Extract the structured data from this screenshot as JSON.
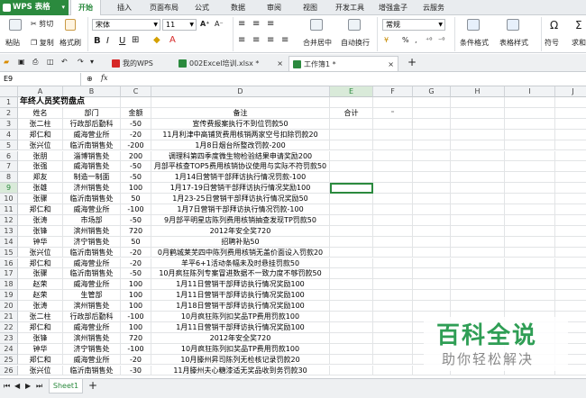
{
  "app": {
    "title": "WPS 表格",
    "accent": "#2b8a3e"
  },
  "menu": {
    "tabs": [
      "开始",
      "插入",
      "页面布局",
      "公式",
      "数据",
      "审阅",
      "视图",
      "开发工具",
      "增强盒子",
      "云服务"
    ],
    "active": "开始"
  },
  "ribbon": {
    "cut": "剪切",
    "paste": "粘贴",
    "copy": "复制",
    "format_painter": "格式刷",
    "font_name": "宋体",
    "font_size": "11",
    "bold": "B",
    "italic": "I",
    "underline": "U",
    "font_grow": "A⁺",
    "font_shrink": "A⁻",
    "merge_center": "合并居中",
    "wrap": "自动换行",
    "number_format": "常规",
    "percent": "%",
    "comma": "‚",
    "dec_inc": "⁺⁰",
    "dec_dec": "⁻⁰",
    "cond_format": "条件格式",
    "table_style": "表格样式",
    "symbol": "符号",
    "sum": "求和",
    "icons": [
      "scissors-icon",
      "paste-icon",
      "copy-icon",
      "brush-icon"
    ]
  },
  "doc_tabs": [
    "我的WPS",
    "002Excel培训.xlsx *",
    "工作簿1 *"
  ],
  "doc_tab_new": "+",
  "formula_bar": {
    "name_box": "E9",
    "fx": "fx",
    "value": ""
  },
  "columns": [
    "A",
    "B",
    "C",
    "D",
    "E",
    "F",
    "G",
    "H",
    "I",
    "J"
  ],
  "rows": [
    {
      "n": "1",
      "a": "年终人员奖罚盘点",
      "b": "",
      "c": "",
      "d": "",
      "e": "",
      "f": ""
    },
    {
      "n": "2",
      "a": "姓名",
      "b": "部门",
      "c": "金额",
      "d": "备注",
      "e": "合计",
      "f": "⁼"
    },
    {
      "n": "3",
      "a": "张二柱",
      "b": "行政部后勤科",
      "c": "-50",
      "d": "宣传费报案执行不到位罚款50",
      "e": "",
      "f": ""
    },
    {
      "n": "4",
      "a": "郑仁和",
      "b": "威海营业所",
      "c": "-20",
      "d": "11月利津中高铺货费用核销两家空号扣除罚款20",
      "e": "",
      "f": ""
    },
    {
      "n": "5",
      "a": "张兴位",
      "b": "临沂南销售处",
      "c": "-200",
      "d": "1月8日烟台所整改罚款-200",
      "e": "",
      "f": ""
    },
    {
      "n": "6",
      "a": "张朋",
      "b": "淄博销售处",
      "c": "200",
      "d": "调理科第四季度微生物检验结果申请奖励200",
      "e": "",
      "f": ""
    },
    {
      "n": "7",
      "a": "张强",
      "b": "威海销售处",
      "c": "-50",
      "d": "月部平核查TOP5费用核销协议使用与实际不符罚款50",
      "e": "",
      "f": ""
    },
    {
      "n": "8",
      "a": "郑友",
      "b": "制造一制面",
      "c": "-50",
      "d": "1月14日营销干部拜访执行情况罚款-100",
      "e": "",
      "f": ""
    },
    {
      "n": "9",
      "a": "张雄",
      "b": "济州销售处",
      "c": "100",
      "d": "1月17-19日营销干部拜访执行情况奖励100",
      "e": "",
      "f": ""
    },
    {
      "n": "10",
      "a": "张骤",
      "b": "临沂南销售处",
      "c": "50",
      "d": "1月23-25日营销干部拜访执行情况奖励50",
      "e": "",
      "f": ""
    },
    {
      "n": "11",
      "a": "郑仁和",
      "b": "威海营业所",
      "c": "-100",
      "d": "1月7日营销干部拜访执行情况罚款-100",
      "e": "",
      "f": ""
    },
    {
      "n": "12",
      "a": "张涛",
      "b": "市场部",
      "c": "-50",
      "d": "9月部平明星店陈列费用核销抽查发现TP罚款50",
      "e": "",
      "f": ""
    },
    {
      "n": "13",
      "a": "张锋",
      "b": "滨州销售处",
      "c": "720",
      "d": "2012年安全奖720",
      "e": "",
      "f": ""
    },
    {
      "n": "14",
      "a": "钟华",
      "b": "济宁销售处",
      "c": "50",
      "d": "招聘补贴50",
      "e": "",
      "f": ""
    },
    {
      "n": "15",
      "a": "张兴位",
      "b": "临沂南销售处",
      "c": "-20",
      "d": "0月鹤城莱芜四中陈列费用核销无盖价面设入罚款20",
      "e": "",
      "f": ""
    },
    {
      "n": "16",
      "a": "郑仁和",
      "b": "威海营业所",
      "c": "-20",
      "d": "羊平6+1活动条幅未及时悬挂罚款50",
      "e": "",
      "f": ""
    },
    {
      "n": "17",
      "a": "张骤",
      "b": "临沂南销售处",
      "c": "-50",
      "d": "10月疯狂陈列专案冒进数据不一致力度不够罚款50",
      "e": "",
      "f": ""
    },
    {
      "n": "18",
      "a": "赵荣",
      "b": "威海营业所",
      "c": "100",
      "d": "1月11日营销干部拜访执行情况奖励100",
      "e": "",
      "f": ""
    },
    {
      "n": "19",
      "a": "赵荣",
      "b": "生管部",
      "c": "100",
      "d": "1月11日营销干部拜访执行情况奖励100",
      "e": "",
      "f": ""
    },
    {
      "n": "20",
      "a": "张涛",
      "b": "滨州销售处",
      "c": "100",
      "d": "1月18日营销干部拜访执行情况奖励100",
      "e": "",
      "f": ""
    },
    {
      "n": "21",
      "a": "张二柱",
      "b": "行政部后勤科",
      "c": "-100",
      "d": "10月疯狂陈列扣奖品TP费用罚款100",
      "e": "",
      "f": ""
    },
    {
      "n": "22",
      "a": "郑仁和",
      "b": "威海营业所",
      "c": "100",
      "d": "1月11日营销干部拜访执行情况奖励100",
      "e": "",
      "f": ""
    },
    {
      "n": "23",
      "a": "张锋",
      "b": "滨州销售处",
      "c": "720",
      "d": "2012年安全奖720",
      "e": "",
      "f": ""
    },
    {
      "n": "24",
      "a": "钟华",
      "b": "济宁销售处",
      "c": "-100",
      "d": "10月疯狂陈列扣奖品TP费用罚款100",
      "e": "",
      "f": ""
    },
    {
      "n": "25",
      "a": "郑仁和",
      "b": "威海营业所",
      "c": "-20",
      "d": "10月滕州昇司陈列无检核记录罚款20",
      "e": "",
      "f": ""
    },
    {
      "n": "26",
      "a": "张兴位",
      "b": "临沂南销售处",
      "c": "-30",
      "d": "11月滕州夫心糖漆适无奖品收到务罚款30",
      "e": "",
      "f": ""
    }
  ],
  "sheets": {
    "tabs": [
      "Sheet1"
    ],
    "add": "+"
  },
  "watermark": {
    "title": "百科全说",
    "subtitle": "助你轻松解决"
  }
}
